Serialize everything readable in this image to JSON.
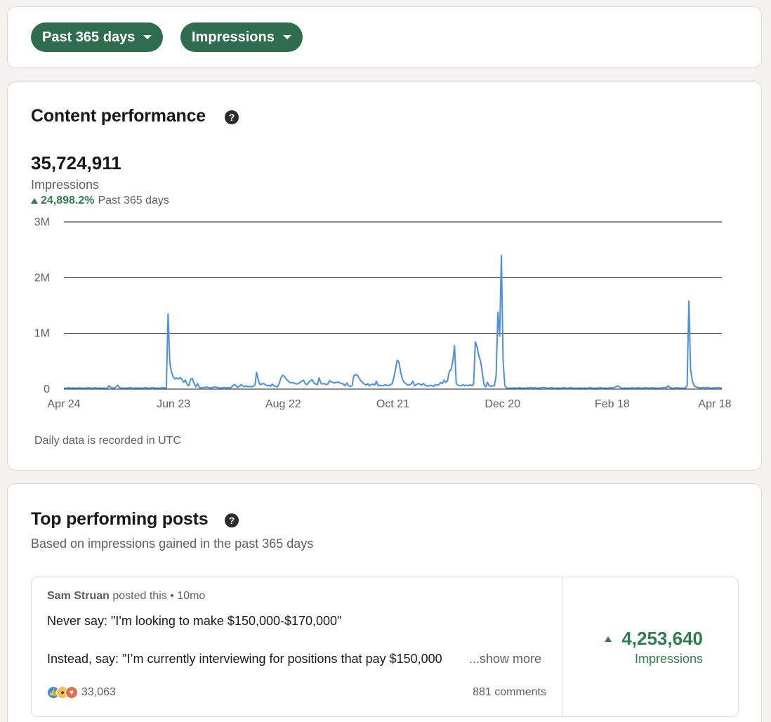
{
  "filters": {
    "range_label": "Past 365 days",
    "metric_label": "Impressions"
  },
  "performance": {
    "title": "Content performance",
    "help_icon": "question-circle-icon",
    "total_value": "35,724,911",
    "total_label": "Impressions",
    "trend_percent": "24,898.2%",
    "trend_period": "Past 365 days",
    "note": "Daily data is recorded in UTC"
  },
  "chart_data": {
    "type": "line",
    "title": "",
    "xlabel": "",
    "ylabel": "",
    "ylim": [
      0,
      3000000
    ],
    "yticks": [
      0,
      1000000,
      2000000,
      3000000
    ],
    "ytick_labels": [
      "0",
      "1M",
      "2M",
      "3M"
    ],
    "xtick_labels": [
      "Apr 24",
      "Jun 23",
      "Aug 22",
      "Oct 21",
      "Dec 20",
      "Feb 18",
      "Apr 18"
    ],
    "grid": true,
    "color": "#4a8fe7",
    "series": [
      {
        "values": [
          20000,
          15000,
          20000,
          25000,
          15000,
          20000,
          20000,
          15000,
          20000,
          25000,
          15000,
          20000,
          15000,
          20000,
          25000,
          20000,
          15000,
          20000,
          25000,
          20000,
          15000,
          20000,
          15000,
          20000,
          15000,
          20000,
          60000,
          30000,
          20000,
          15000,
          40000,
          70000,
          25000,
          20000,
          15000,
          20000,
          15000,
          20000,
          25000,
          20000,
          15000,
          20000,
          20000,
          15000,
          20000,
          15000,
          20000,
          25000,
          20000,
          15000,
          20000,
          30000,
          20000,
          15000,
          20000,
          15000,
          20000,
          25000,
          20000,
          15000,
          1350000,
          480000,
          300000,
          220000,
          180000,
          200000,
          180000,
          210000,
          170000,
          120000,
          160000,
          80000,
          60000,
          180000,
          190000,
          100000,
          40000,
          100000,
          30000,
          20000,
          30000,
          25000,
          40000,
          30000,
          25000,
          20000,
          35000,
          40000,
          30000,
          25000,
          20000,
          20000,
          30000,
          25000,
          20000,
          25000,
          20000,
          50000,
          80000,
          70000,
          30000,
          50000,
          80000,
          60000,
          40000,
          60000,
          40000,
          50000,
          40000,
          50000,
          70000,
          300000,
          160000,
          80000,
          90000,
          100000,
          80000,
          60000,
          70000,
          50000,
          90000,
          60000,
          50000,
          40000,
          100000,
          200000,
          250000,
          230000,
          180000,
          150000,
          120000,
          110000,
          120000,
          100000,
          90000,
          100000,
          120000,
          140000,
          160000,
          100000,
          80000,
          120000,
          150000,
          170000,
          110000,
          90000,
          80000,
          200000,
          110000,
          90000,
          100000,
          80000,
          90000,
          150000,
          130000,
          120000,
          110000,
          120000,
          130000,
          110000,
          100000,
          90000,
          60000,
          110000,
          60000,
          50000,
          60000,
          240000,
          260000,
          250000,
          200000,
          150000,
          120000,
          90000,
          70000,
          100000,
          60000,
          80000,
          90000,
          70000,
          140000,
          60000,
          70000,
          60000,
          60000,
          80000,
          70000,
          60000,
          80000,
          90000,
          200000,
          350000,
          520000,
          480000,
          300000,
          180000,
          120000,
          100000,
          70000,
          80000,
          90000,
          140000,
          60000,
          80000,
          100000,
          90000,
          70000,
          100000,
          70000,
          60000,
          50000,
          70000,
          60000,
          50000,
          80000,
          70000,
          80000,
          120000,
          100000,
          160000,
          120000,
          150000,
          320000,
          350000,
          500000,
          780000,
          100000,
          70000,
          60000,
          60000,
          80000,
          60000,
          70000,
          60000,
          80000,
          60000,
          90000,
          850000,
          750000,
          600000,
          500000,
          300000,
          80000,
          40000,
          120000,
          60000,
          50000,
          60000,
          60000,
          250000,
          1380000,
          950000,
          2400000,
          500000,
          60000,
          20000,
          15000,
          20000,
          15000,
          20000,
          20000,
          15000,
          25000,
          20000,
          15000,
          20000,
          15000,
          25000,
          20000,
          30000,
          20000,
          25000,
          20000,
          15000,
          20000,
          25000,
          30000,
          25000,
          20000,
          15000,
          20000,
          25000,
          20000,
          15000,
          20000,
          20000,
          15000,
          20000,
          25000,
          20000,
          15000,
          20000,
          25000,
          20000,
          15000,
          20000,
          15000,
          20000,
          20000,
          15000,
          20000,
          15000,
          20000,
          25000,
          20000,
          15000,
          20000,
          15000,
          20000,
          25000,
          20000,
          15000,
          20000,
          15000,
          20000,
          25000,
          20000,
          30000,
          40000,
          60000,
          40000,
          20000,
          15000,
          20000,
          15000,
          20000,
          15000,
          25000,
          20000,
          15000,
          20000,
          25000,
          20000,
          15000,
          20000,
          25000,
          20000,
          15000,
          20000,
          25000,
          20000,
          15000,
          20000,
          15000,
          20000,
          25000,
          30000,
          20000,
          60000,
          30000,
          20000,
          15000,
          20000,
          25000,
          20000,
          15000,
          20000,
          15000,
          20000,
          60000,
          1580000,
          350000,
          150000,
          60000,
          40000,
          30000,
          25000,
          20000,
          30000,
          25000,
          20000,
          30000,
          20000,
          15000,
          20000,
          25000,
          20000,
          30000,
          20000,
          15000
        ]
      }
    ]
  },
  "posts": {
    "title": "Top performing posts",
    "subtitle": "Based on impressions gained in the past 365 days",
    "items": [
      {
        "author": "Sam Struan",
        "posted_text": "posted this",
        "separator": "•",
        "age": "10mo",
        "line1": "Never say: \"I'm looking to make $150,000-$170,000\"",
        "line2": "Instead, say: \"I’m currently interviewing for positions that pay $150,000",
        "show_more": "...show more",
        "reaction_icons": [
          "like-icon",
          "insightful-icon",
          "love-icon"
        ],
        "reaction_count": "33,063",
        "comments": "881 comments",
        "impressions_value": "4,253,640",
        "impressions_label": "Impressions"
      }
    ]
  }
}
